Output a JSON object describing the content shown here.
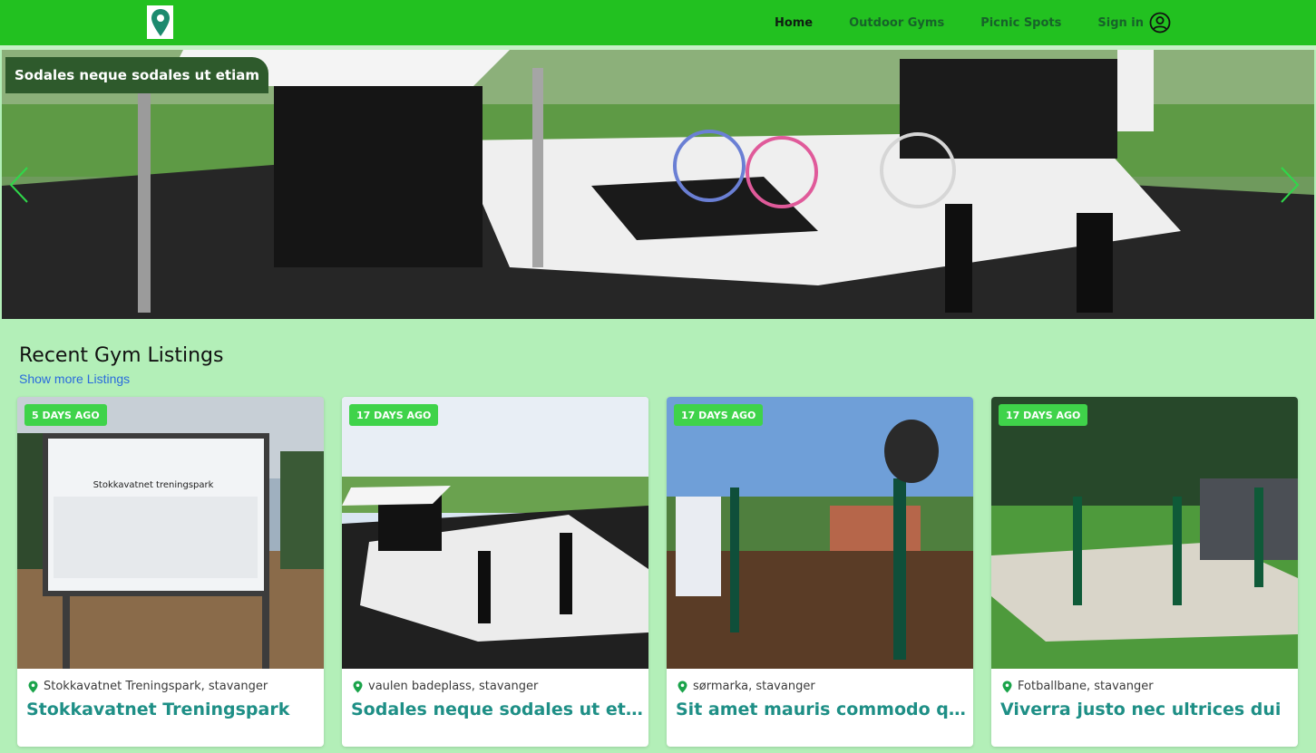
{
  "nav": {
    "links": [
      {
        "label": "Home",
        "active": true
      },
      {
        "label": "Outdoor Gyms",
        "active": false
      },
      {
        "label": "Picnic Spots",
        "active": false
      },
      {
        "label": "Sign in",
        "active": false
      }
    ]
  },
  "hero": {
    "caption": "Sodales neque sodales ut etiam"
  },
  "listings": {
    "title": "Recent Gym Listings",
    "show_more": "Show more Listings",
    "cards": [
      {
        "badge": "5 DAYS AGO",
        "location": "Stokkavatnet Treningspark, stavanger",
        "title": "Stokkavatnet Treningspark"
      },
      {
        "badge": "17 DAYS AGO",
        "location": "vaulen badeplass, stavanger",
        "title": "Sodales neque sodales ut etiam"
      },
      {
        "badge": "17 DAYS AGO",
        "location": "sørmarka, stavanger",
        "title": "Sit amet mauris commodo quis imperdiet"
      },
      {
        "badge": "17 DAYS AGO",
        "location": "Fotballbane, stavanger",
        "title": "Viverra justo nec ultrices dui"
      }
    ]
  },
  "colors": {
    "navbar": "#22c120",
    "page_bg": "#b3efb8",
    "badge": "#3fd34a",
    "card_title": "#1e8f86",
    "link": "#2a6bdc"
  }
}
